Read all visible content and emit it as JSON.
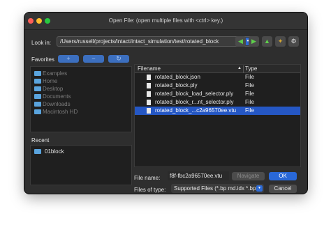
{
  "window": {
    "title": "Open File:  (open multiple files with <ctrl> key.)"
  },
  "lookin": {
    "label": "Look in:",
    "path": "/Users/russell/projects/intact/intact_simulation/test/rotated_block",
    "arrow": "▾"
  },
  "toolbar": {
    "back_icon": "arrow-left-icon",
    "back_glyph": "◀",
    "forward_icon": "arrow-right-icon",
    "forward_glyph": "▶",
    "up_icon": "arrow-up-icon",
    "up_glyph": "▲",
    "newfolder_icon": "new-folder-icon",
    "newfolder_glyph": "✦",
    "settings_icon": "gear-icon",
    "settings_glyph": "⚙"
  },
  "favorites": {
    "label": "Favorites",
    "add_glyph": "+",
    "remove_glyph": "−",
    "refresh_glyph": "↻",
    "items": [
      "Examples",
      "Home",
      "Desktop",
      "Documents",
      "Downloads",
      "Macintosh HD"
    ]
  },
  "recent": {
    "label": "Recent",
    "items": [
      "01block"
    ]
  },
  "files": {
    "columns": {
      "name": "Filename",
      "type": "Type"
    },
    "sort_glyph": "▲",
    "rows": [
      {
        "name": "rotated_block.json",
        "type": "File"
      },
      {
        "name": "rotated_block.ply",
        "type": "File"
      },
      {
        "name": "rotated_block_load_selector.ply",
        "type": "File"
      },
      {
        "name": "rotated_block_r...nt_selector.ply",
        "type": "File"
      },
      {
        "name": "rotated_block_...c2a96570ee.vtu",
        "type": "File"
      }
    ],
    "selected_index": 4
  },
  "filename": {
    "label": "File name:",
    "value": "f8f-fbc2a96570ee.vtu"
  },
  "filetype": {
    "label": "Files of type:",
    "value": "Supported Files (*.bp md.idx *.bp",
    "arrow": "▾"
  },
  "buttons": {
    "navigate": "Navigate",
    "ok": "OK",
    "cancel": "Cancel"
  },
  "colors": {
    "accent": "#2968d8",
    "selection": "#2557c4",
    "window_bg": "#2e2e2e"
  }
}
